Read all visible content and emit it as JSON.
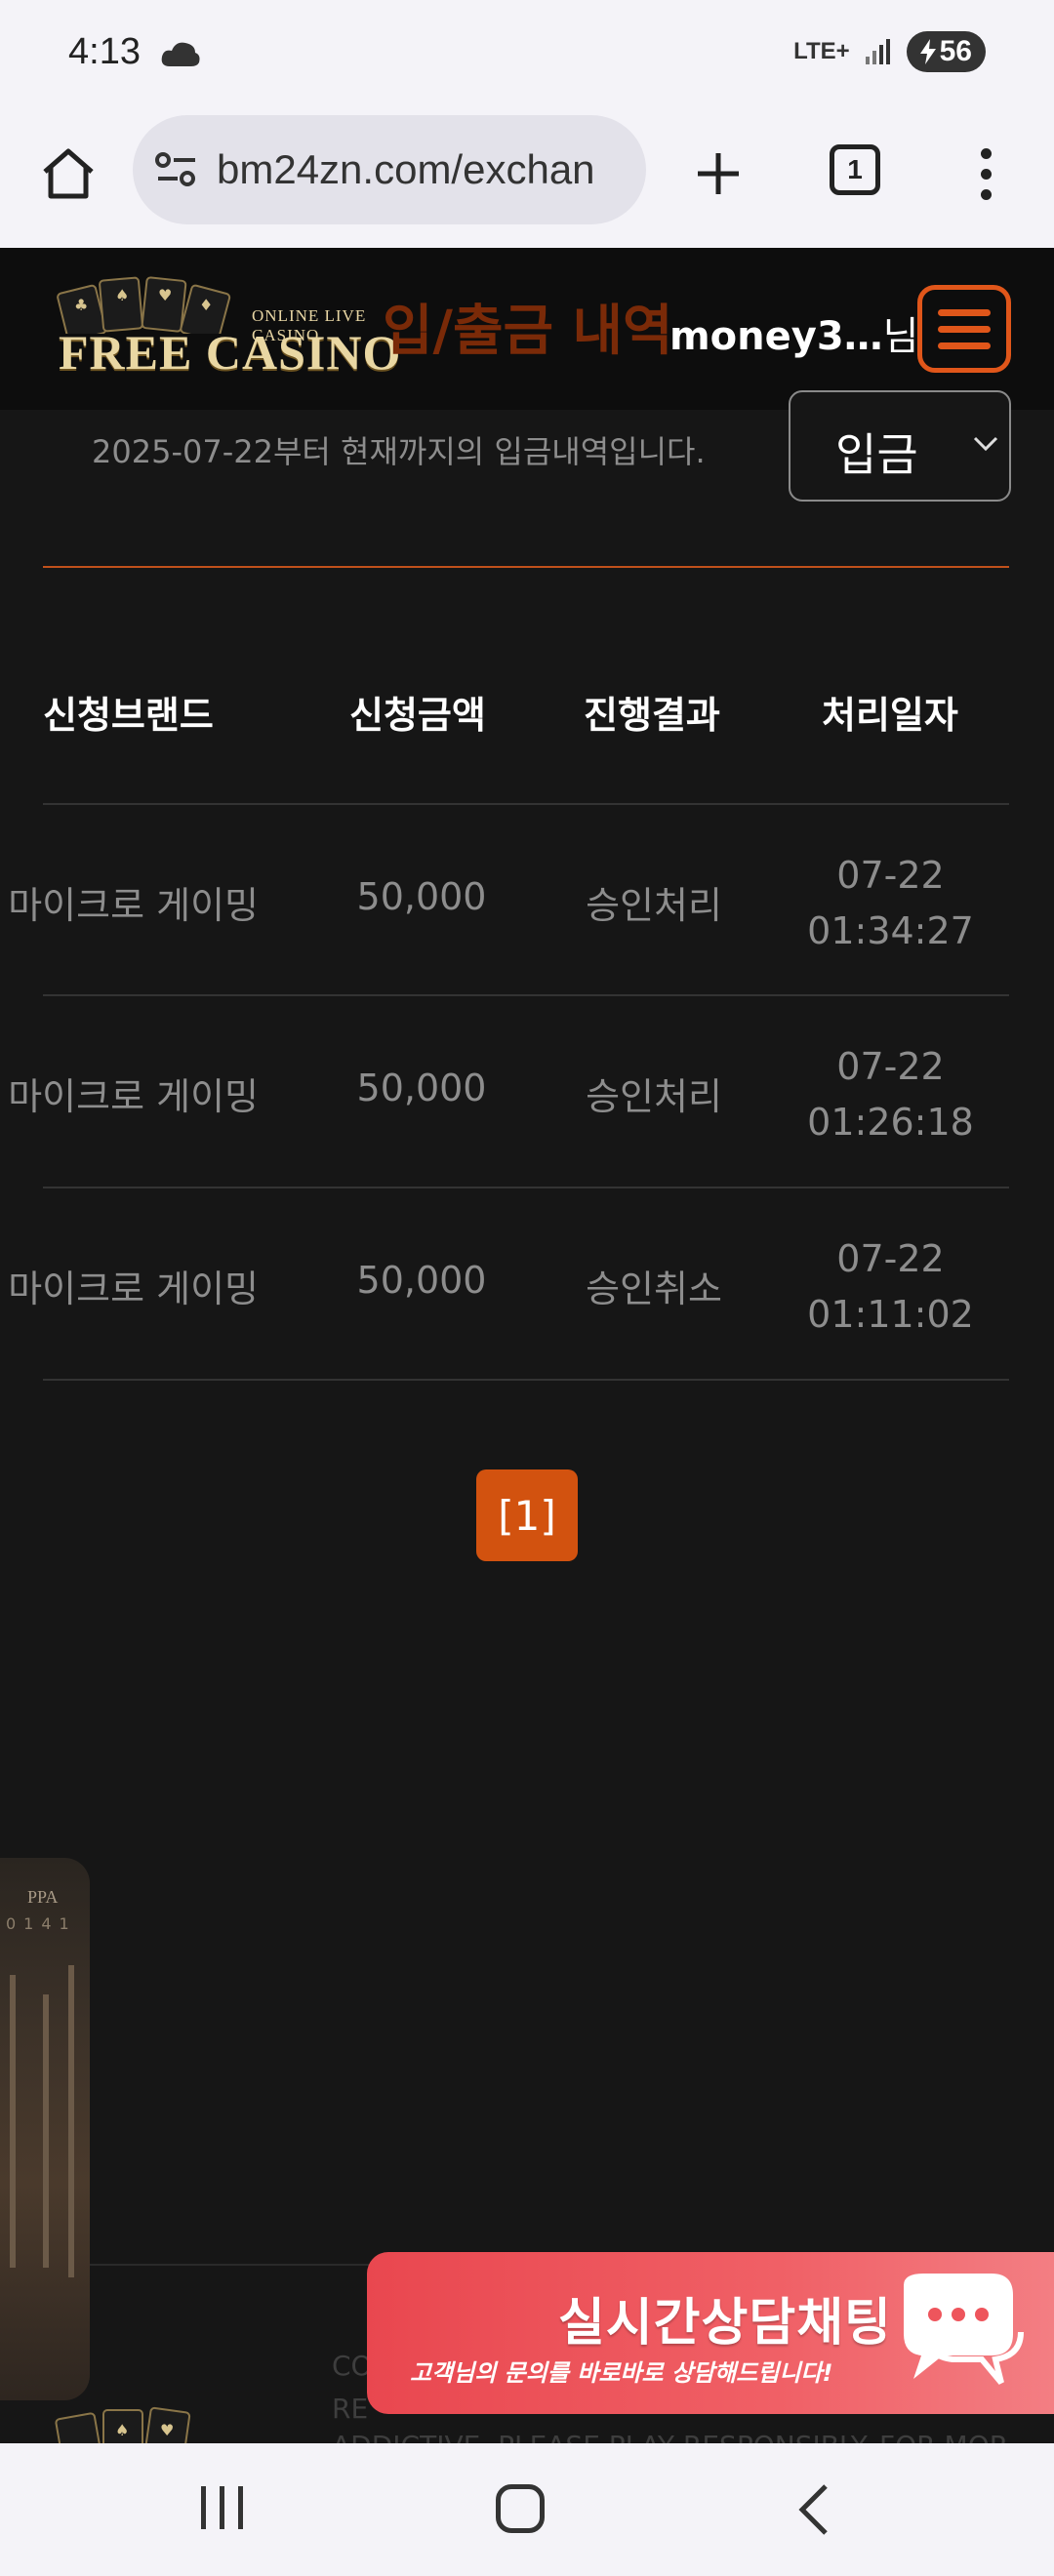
{
  "status_bar": {
    "time": "4:13",
    "network": "LTE+",
    "battery": "56"
  },
  "browser": {
    "url": "bm24zn.com/exchan",
    "tab_count": "1"
  },
  "header": {
    "logo_sub": "ONLINE LIVE CASINO",
    "logo_main": "FREE CASINO",
    "page_title": "입/출금 내역",
    "username": "money3…",
    "username_suffix": "님"
  },
  "filter": {
    "info_text": "2025-07-22부터 현재까지의 입금내역입니다.",
    "selected_type": "입금"
  },
  "table": {
    "headers": [
      "신청브랜드",
      "신청금액",
      "진행결과",
      "처리일자"
    ],
    "rows": [
      {
        "brand": "마이크로 게이밍",
        "amount": "50,000",
        "result": "승인처리",
        "date": "07-22",
        "time": "01:34:27"
      },
      {
        "brand": "마이크로 게이밍",
        "amount": "50,000",
        "result": "승인처리",
        "date": "07-22",
        "time": "01:26:18"
      },
      {
        "brand": "마이크로 게이밍",
        "amount": "50,000",
        "result": "승인취소",
        "date": "07-22",
        "time": "01:11:02"
      }
    ]
  },
  "pagination": {
    "current": "[1]"
  },
  "side_banner": {
    "text": "PPA",
    "digits": "0141"
  },
  "footer": {
    "line1": "CO",
    "line2": "RE",
    "line3": "ADDICTIVE. PLEASE PLAY RESPONSIBLY. FOR MORE"
  },
  "chat_banner": {
    "title": "실시간상담채팅",
    "subtitle": "고객님의 문의를 바로바로 상담해드립니다!"
  },
  "colors": {
    "accent": "#e0561a",
    "background": "#161616",
    "chat": "#ee555c"
  }
}
